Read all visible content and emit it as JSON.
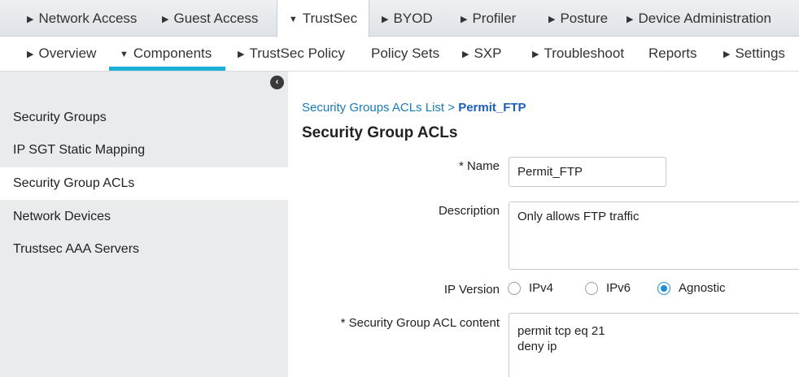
{
  "top_nav": {
    "tabs": [
      {
        "label": "Network Access",
        "active": false
      },
      {
        "label": "Guest Access",
        "active": false
      },
      {
        "label": "TrustSec",
        "active": true
      },
      {
        "label": "BYOD",
        "active": false
      },
      {
        "label": "Profiler",
        "active": false
      },
      {
        "label": "Posture",
        "active": false
      },
      {
        "label": "Device Administration",
        "active": false
      }
    ]
  },
  "sub_nav": {
    "tabs": [
      {
        "label": "Overview",
        "has_caret": true
      },
      {
        "label": "Components",
        "has_caret": true,
        "active": true
      },
      {
        "label": "TrustSec Policy",
        "has_caret": true
      },
      {
        "label": "Policy Sets",
        "has_caret": false
      },
      {
        "label": "SXP",
        "has_caret": true
      },
      {
        "label": "Troubleshoot",
        "has_caret": true
      },
      {
        "label": "Reports",
        "has_caret": false
      },
      {
        "label": "Settings",
        "has_caret": true
      }
    ],
    "accent_color": "#1ab0d8"
  },
  "sidebar": {
    "collapse_icon": "chevron-left-icon",
    "items": [
      {
        "label": "Security Groups",
        "selected": false
      },
      {
        "label": "IP SGT Static Mapping",
        "selected": false
      },
      {
        "label": "Security Group ACLs",
        "selected": true
      },
      {
        "label": "Network Devices",
        "selected": false
      },
      {
        "label": "Trustsec AAA Servers",
        "selected": false
      }
    ]
  },
  "main": {
    "breadcrumb": {
      "parent": "Security Groups ACLs List",
      "separator": ">",
      "current": "Permit_FTP"
    },
    "title": "Security Group ACLs",
    "form": {
      "name_label": "* Name",
      "name_value": "Permit_FTP",
      "description_label": "Description",
      "description_value": "Only allows FTP traffic",
      "ip_version_label": "IP Version",
      "ip_version_options": [
        {
          "label": "IPv4",
          "checked": false
        },
        {
          "label": "IPv6",
          "checked": false
        },
        {
          "label": "Agnostic",
          "checked": true
        }
      ],
      "acl_content_label": "* Security Group ACL content",
      "acl_content_value": "permit tcp eq 21\ndeny ip"
    }
  }
}
